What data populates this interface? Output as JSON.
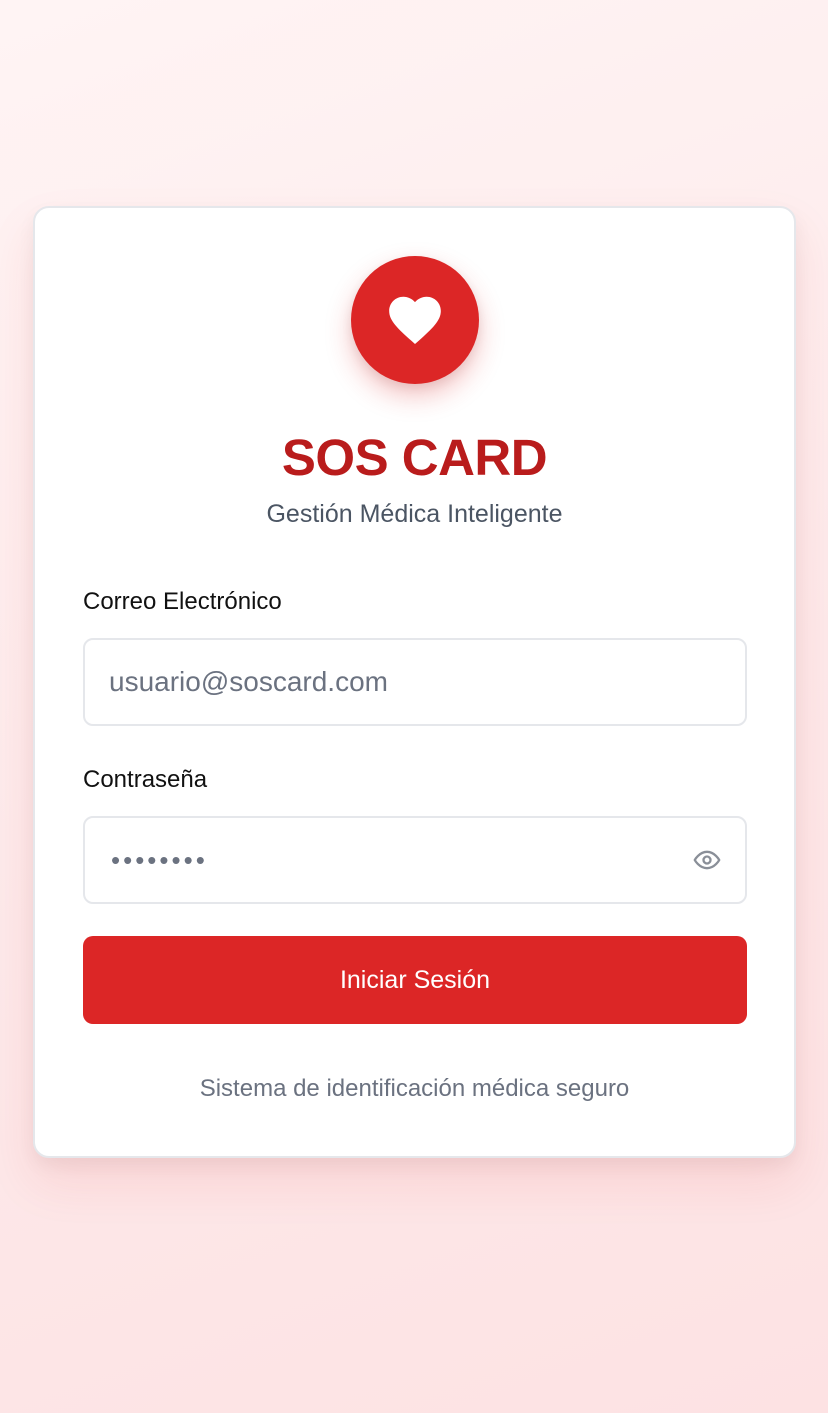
{
  "app": {
    "title": "SOS CARD",
    "subtitle": "Gestión Médica Inteligente",
    "logo_icon": "heart-icon",
    "accent_color": "#dc2626",
    "title_color": "#b91c1c"
  },
  "form": {
    "email": {
      "label": "Correo Electrónico",
      "placeholder": "usuario@soscard.com",
      "value": ""
    },
    "password": {
      "label": "Contraseña",
      "masked_value": "••••••••",
      "toggle_icon": "eye-icon"
    },
    "submit_label": "Iniciar Sesión"
  },
  "footer": {
    "text": "Sistema de identificación médica seguro"
  }
}
